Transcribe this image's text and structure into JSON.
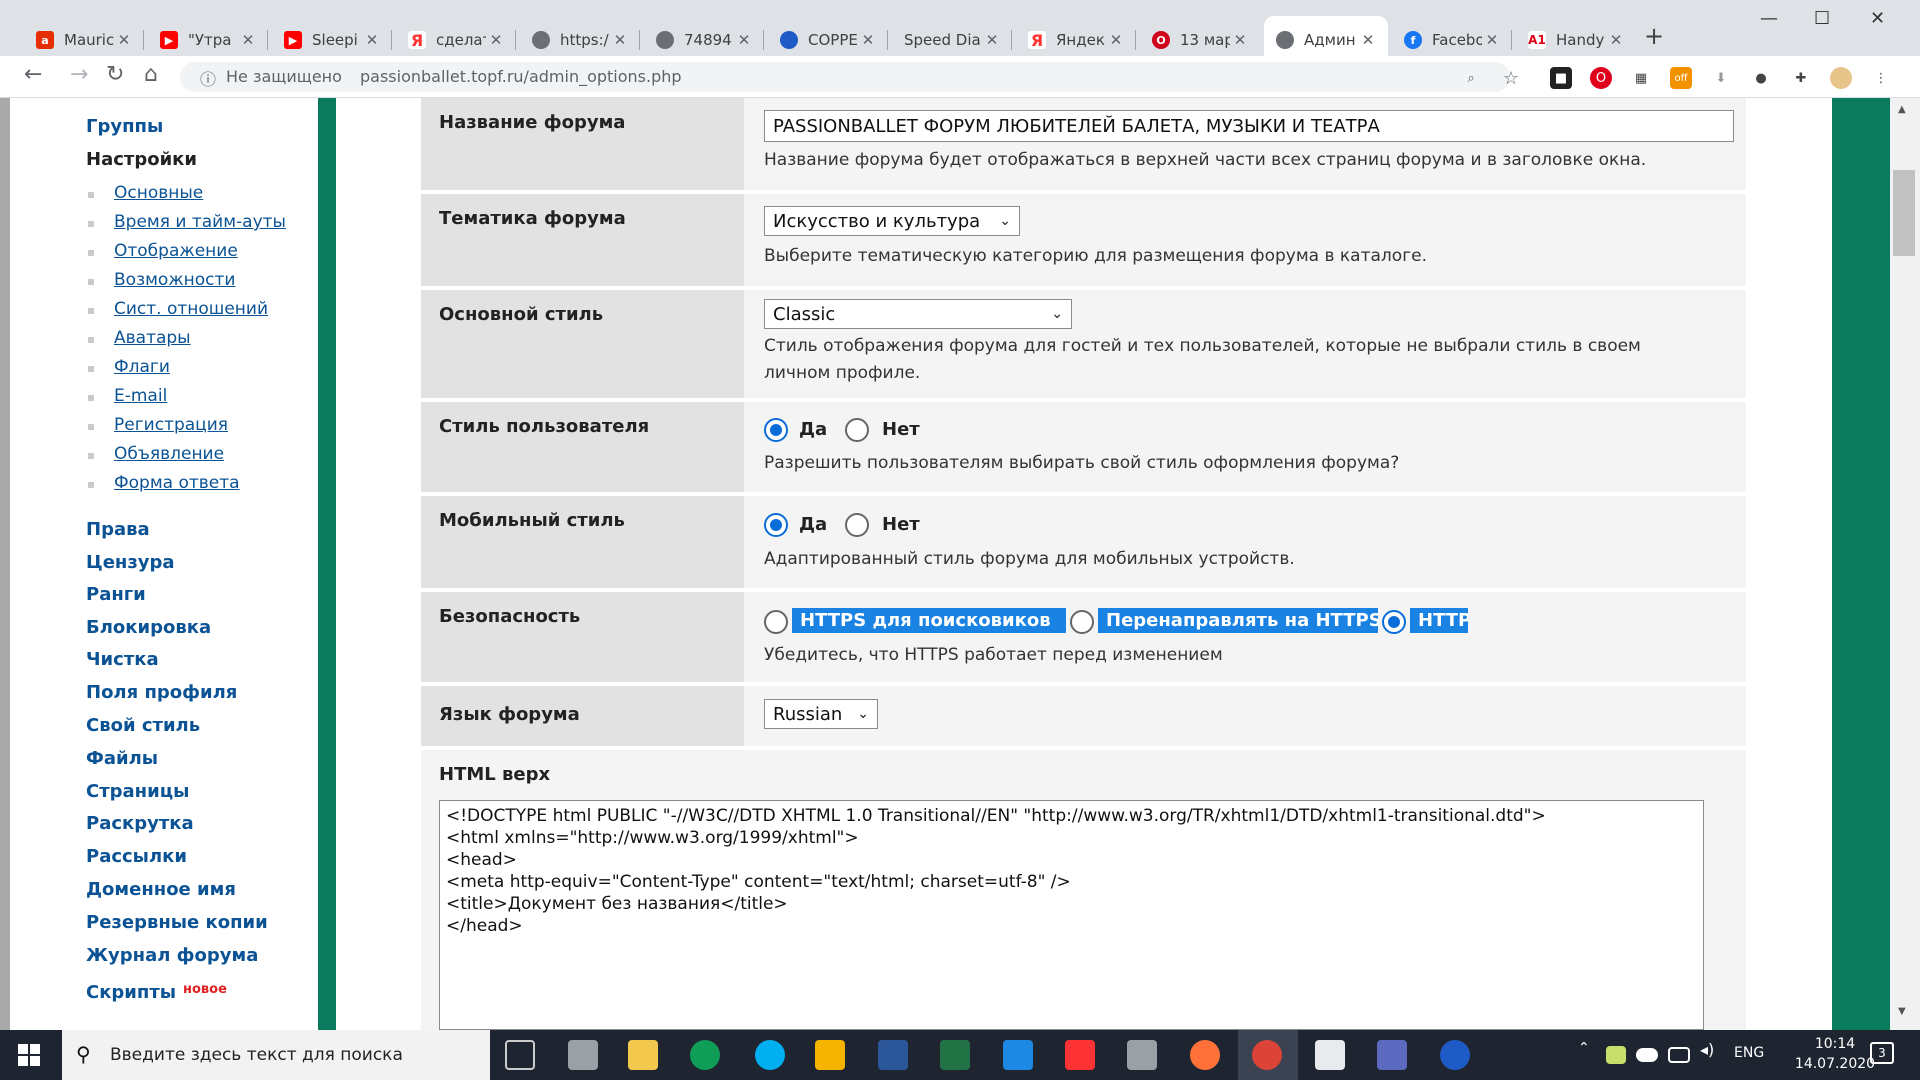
{
  "browser": {
    "tabs": [
      {
        "title": "Mauric",
        "icon": "ali-icon",
        "color": "#e62e04"
      },
      {
        "title": "\"Утра",
        "icon": "youtube-icon",
        "color": "#ff0000"
      },
      {
        "title": "Sleepi",
        "icon": "youtube-icon",
        "color": "#ff0000"
      },
      {
        "title": "сделат",
        "icon": "yandex-icon",
        "color": "#ff3333"
      },
      {
        "title": "https:/",
        "icon": "globe-icon",
        "color": "#5f6368"
      },
      {
        "title": "74894",
        "icon": "globe-icon",
        "color": "#5f6368"
      },
      {
        "title": "COPPE",
        "icon": "coppe-icon",
        "color": "#1e5bc6"
      },
      {
        "title": "Speed Dial",
        "icon": "",
        "color": ""
      },
      {
        "title": "Яндек",
        "icon": "yandex-icon",
        "color": "#ff3333"
      },
      {
        "title": "13 мар",
        "icon": "opera-icon",
        "color": "#d0021b"
      },
      {
        "title": "Админ",
        "icon": "globe-icon",
        "color": "#5f6368",
        "active": true
      },
      {
        "title": "Facebo",
        "icon": "facebook-icon",
        "color": "#1877f2"
      },
      {
        "title": "Handy",
        "icon": "a1-icon",
        "color": "#e0001b"
      }
    ],
    "new_tab": "+",
    "url_not_secure": "Не защищено",
    "url": "passionballet.topf.ru/admin_options.php"
  },
  "sidebar": {
    "groups_label": "Группы",
    "settings_label": "Настройки",
    "settings_items": [
      "Основные",
      "Время и тайм-ауты",
      "Отображение",
      "Возможности",
      "Сист. отношений",
      "Аватары",
      "Флаги",
      "E-mail",
      "Регистрация",
      "Объявление",
      "Форма ответа"
    ],
    "items": [
      "Права",
      "Цензура",
      "Ранги",
      "Блокировка",
      "Чистка",
      "Поля профиля",
      "Свой стиль",
      "Файлы",
      "Страницы",
      "Раскрутка",
      "Рассылки",
      "Доменное имя",
      "Резервные копии",
      "Журнал форума"
    ],
    "scripts_label": "Скрипты",
    "scripts_badge": "новое"
  },
  "form": {
    "forum_name": {
      "label": "Название форума",
      "value": "PASSIONBALLET ФОРУМ ЛЮБИТЕЛЕЙ БАЛЕТА, МУЗЫКИ И ТЕАТРА",
      "desc": "Название форума будет отображаться в верхней части всех страниц форума и в заголовке окна."
    },
    "forum_topic": {
      "label": "Тематика форума",
      "value": "Искусство и культура",
      "desc": "Выберите тематическую категорию для размещения форума в каталоге."
    },
    "main_style": {
      "label": "Основной стиль",
      "value": "Classic",
      "desc": "Стиль отображения форума для гостей и тех пользователей, которые не выбрали стиль в своем личном профиле."
    },
    "user_style": {
      "label": "Стиль пользователя",
      "yes": "Да",
      "no": "Нет",
      "selected": "yes",
      "desc": "Разрешить пользователям выбирать свой стиль оформления форума?"
    },
    "mobile_style": {
      "label": "Мобильный стиль",
      "yes": "Да",
      "no": "Нет",
      "selected": "yes",
      "desc": "Адаптированный стиль форума для мобильных устройств."
    },
    "security": {
      "label": "Безопасность",
      "options": [
        "HTTPS для поисковиков",
        "Перенаправлять на HTTPS",
        "HTTP"
      ],
      "selected": "HTTP",
      "desc": "Убедитесь, что HTTPS работает перед изменением"
    },
    "language": {
      "label": "Язык форума",
      "value": "Russian"
    },
    "html_top": {
      "label": "HTML верх",
      "code": "<!DOCTYPE html PUBLIC \"-//W3C//DTD XHTML 1.0 Transitional//EN\" \"http://www.w3.org/TR/xhtml1/DTD/xhtml1-transitional.dtd\">\n<html xmlns=\"http://www.w3.org/1999/xhtml\">\n<head>\n<meta http-equiv=\"Content-Type\" content=\"text/html; charset=utf-8\" />\n<title>Документ без названия</title>\n</head>"
    }
  },
  "taskbar": {
    "search_placeholder": "Введите здесь текст для поиска",
    "lang": "ENG",
    "time": "10:14",
    "date": "14.07.2020",
    "notifications": "3"
  },
  "colors": {
    "accent_green": "#0a7b5c",
    "link_blue": "#0b5394",
    "highlight_blue": "#1a82e2"
  }
}
